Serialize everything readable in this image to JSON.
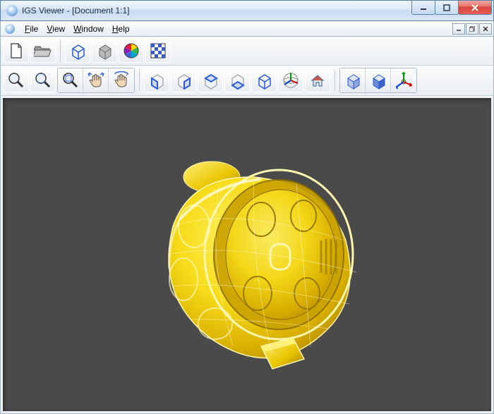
{
  "window": {
    "title": "IGS Viewer - [Document 1:1]"
  },
  "menu": {
    "file": "File",
    "view": "View",
    "window": "Window",
    "help": "Help"
  },
  "icons": {
    "new": "new-document",
    "open": "open-folder",
    "wireframe": "cube-wireframe",
    "solid": "cube-solid",
    "colors": "color-wheel",
    "texture": "checker",
    "zoom_in": "magnifier-plus",
    "zoom_out": "magnifier-minus",
    "zoom_fit": "magnifier-fit",
    "pan": "hand-pan",
    "rotate": "hand-rotate",
    "view_front": "cube-front",
    "view_back": "cube-back",
    "view_left": "cube-left",
    "view_right": "cube-right",
    "view_top": "cube-top",
    "axes": "axes-sphere",
    "home": "home",
    "shade1": "cube-shade-a",
    "shade2": "cube-shade-b",
    "axes2": "axes-tripod"
  }
}
